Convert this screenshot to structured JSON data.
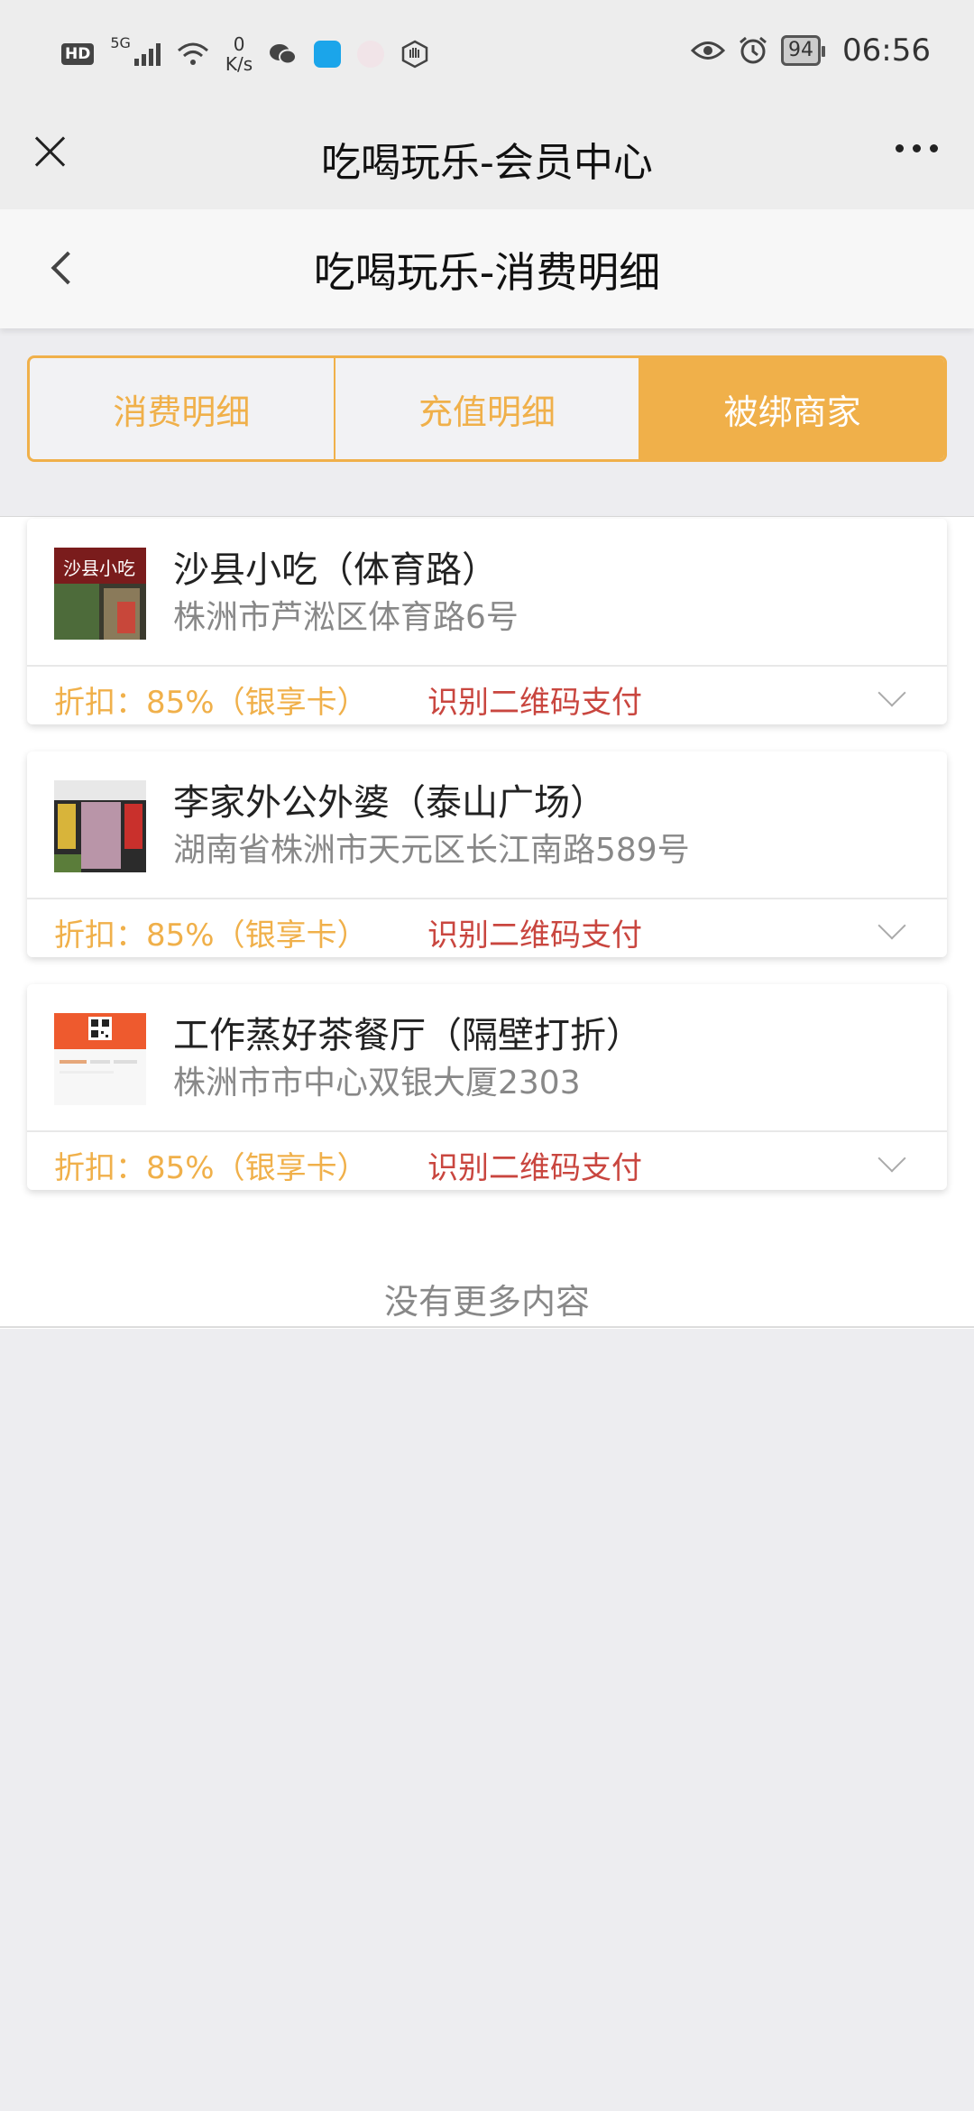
{
  "status_bar": {
    "hd": "HD",
    "network": "5G",
    "speed_value": "0",
    "speed_unit": "K/s",
    "battery": "94",
    "time": "06:56"
  },
  "topnav": {
    "title": "吃喝玩乐-会员中心"
  },
  "subheader": {
    "title": "吃喝玩乐-消费明细"
  },
  "tabs": [
    {
      "label": "消费明细",
      "active": false
    },
    {
      "label": "充值明细",
      "active": false
    },
    {
      "label": "被绑商家",
      "active": true
    }
  ],
  "merchants": [
    {
      "name": "沙县小吃（体育路）",
      "address": "株洲市芦淞区体育路6号",
      "discount": "折扣：85%（银享卡）",
      "pay_label": "识别二维码支付"
    },
    {
      "name": "李家外公外婆（泰山广场）",
      "address": "湖南省株洲市天元区长江南路589号",
      "discount": "折扣：85%（银享卡）",
      "pay_label": "识别二维码支付"
    },
    {
      "name": "工作蒸好茶餐厅（隔壁打折）",
      "address": "株洲市市中心双银大厦2303",
      "discount": "折扣：85%（银享卡）",
      "pay_label": "识别二维码支付"
    }
  ],
  "footer": {
    "no_more": "没有更多内容"
  },
  "colors": {
    "accent": "#f0b04a",
    "pay_link": "#c9463f"
  }
}
